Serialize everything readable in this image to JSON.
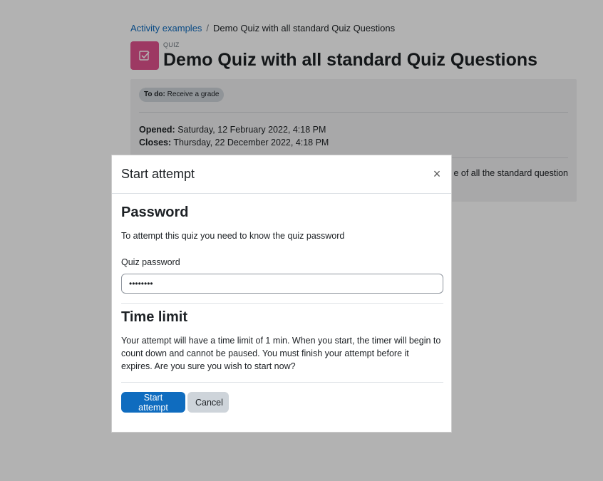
{
  "breadcrumb": {
    "parent": "Activity examples",
    "separator": "/",
    "current": "Demo Quiz with all standard Quiz Questions"
  },
  "activity": {
    "module_label": "QUIZ",
    "title": "Demo Quiz with all standard Quiz Questions",
    "icon": "quiz-checkbox-icon",
    "icon_color": "#e1528f"
  },
  "info": {
    "todo_label": "To do:",
    "todo_text": "Receive a grade",
    "opened_label": "Opened:",
    "opened_value": "Saturday, 12 February 2022, 4:18 PM",
    "closes_label": "Closes:",
    "closes_value": "Thursday, 22 December 2022, 4:18 PM",
    "intro_fragment": "e of all the standard question"
  },
  "modal": {
    "title": "Start attempt",
    "close_symbol": "×",
    "password_heading": "Password",
    "password_description": "To attempt this quiz you need to know the quiz password",
    "password_label": "Quiz password",
    "password_value": "••••••••",
    "time_heading": "Time limit",
    "time_description": "Your attempt will have a time limit of 1 min. When you start, the timer will begin to count down and cannot be paused. You must finish your attempt before it expires. Are you sure you wish to start now?",
    "start_button": "Start attempt",
    "cancel_button": "Cancel"
  },
  "colors": {
    "primary": "#0f6cbf",
    "secondary": "#ced4da",
    "link": "#0f6cbf"
  }
}
